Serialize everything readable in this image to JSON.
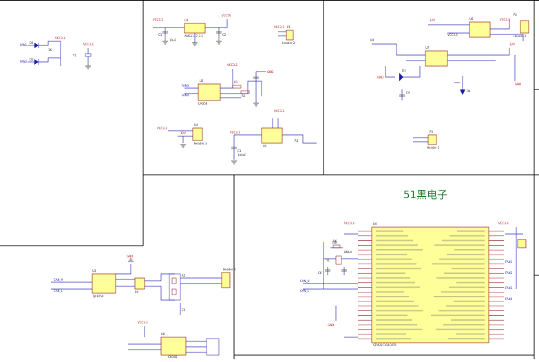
{
  "watermark": "51黑电子",
  "labels": {
    "p1": "VCC3.3",
    "p2": "VCC5V",
    "p3": "VCC3.3",
    "p4": "VCC3.3",
    "p5": "VCC3.3",
    "p6": "VCC3.3",
    "p7": "VCC3.3",
    "p8": "VCC3.3",
    "p9": "12V",
    "p10": "VCC3.3",
    "p11": "12V",
    "p12": "12V",
    "p13": "VCC3.3",
    "p14": "VCC3.3",
    "p15": "VCC3.3",
    "p16": "GND",
    "p17": "GND",
    "p18": "GND",
    "p19": "GND",
    "p20": "GND",
    "p21": "U1",
    "p22": "U2",
    "p23": "U3",
    "p24": "U4",
    "p25": "U5",
    "p26": "U6",
    "p27": "U7",
    "p28": "U8",
    "p29": "U9",
    "p30": "P1",
    "p31": "P2",
    "p32": "P3",
    "p33": "P4",
    "p34": "D1",
    "p35": "D2",
    "p36": "D3",
    "p37": "D4",
    "p38": "FAN1",
    "p39": "FAN2",
    "p40": "FAN3",
    "p41": "FAN4",
    "p42": "AMS1117-3.3",
    "p43": "LM358",
    "p44": "Header 2",
    "p45": "Header 3",
    "p46": "Header 4",
    "p47": "STM32F103C8T6",
    "p48": "C1",
    "p49": "C2",
    "p50": "C3",
    "p51": "C4",
    "p52": "C5",
    "p53": "C6",
    "p54": "R1",
    "p55": "R2",
    "p56": "R3",
    "p57": "R4",
    "p58": "R5",
    "p59": "R6",
    "p60": "Y1",
    "p61": "CAN_H",
    "p62": "CAN_L",
    "p63": "TJA1050",
    "p64": "CH340",
    "p65": "10K",
    "p66": "1K",
    "p67": "100nF",
    "p68": "10uF",
    "p69": "8MHz"
  }
}
